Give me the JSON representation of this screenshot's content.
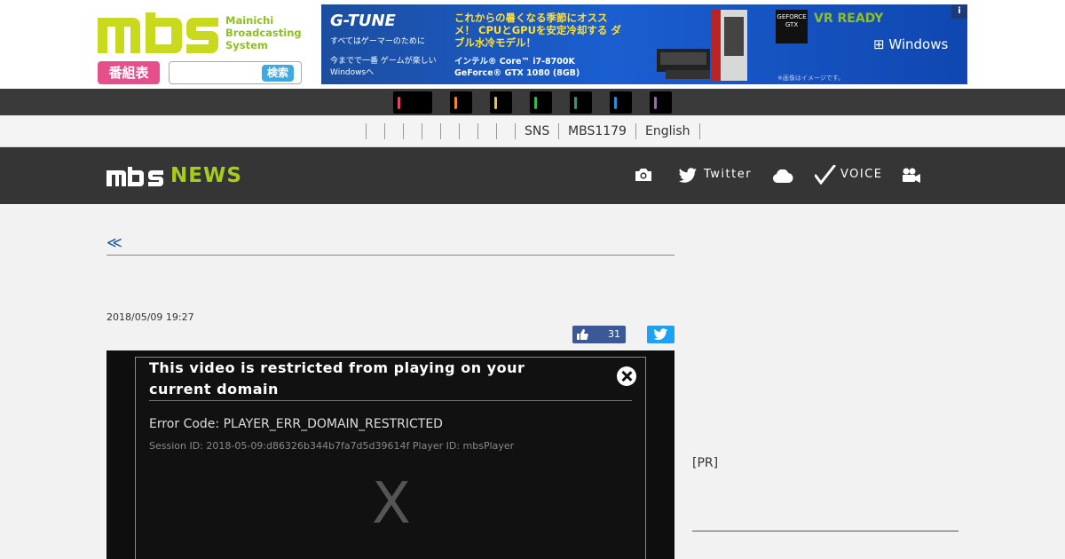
{
  "header": {
    "logo_text": [
      "Mainichi",
      "Broadcasting",
      "System"
    ],
    "program_button": "番組表",
    "search_placeholder": "",
    "search_button": "検索"
  },
  "ad": {
    "brand": "G-TUNE",
    "tagline": "すべてはゲーマーのために",
    "subcopy": "今までで一番 ゲームが楽しい Windowsへ",
    "headline": "これからの暑くなる季節にオススメ！ CPUとGPUを安定冷却する ダブル水冷モデル！",
    "spec": "インテル® Core™ i7-8700K GeForce® GTX 1080 (8GB)",
    "gpu_badge": "GEFORCE GTX",
    "vr_badge": "VR READY",
    "windows": "Windows",
    "note": "※画像はイメージです。",
    "info": "i"
  },
  "channels": [
    {
      "color": "#e8435a"
    },
    {
      "color": "#f08a2c"
    },
    {
      "color": "#f2c230"
    },
    {
      "color": "#3fb44a"
    },
    {
      "color": "#1aa37a"
    },
    {
      "color": "#2f8fd6"
    },
    {
      "color": "#b05ac8"
    }
  ],
  "subnav": {
    "items": [
      "SNS",
      "MBS1179",
      "English"
    ]
  },
  "newsbar": {
    "logo": "NEWS",
    "links": [
      {
        "icon": "camera-icon",
        "label": ""
      },
      {
        "icon": "twitter-icon",
        "label": "Twitter"
      },
      {
        "icon": "cloud-icon",
        "label": ""
      },
      {
        "icon": "check-icon",
        "label": "VOICE"
      },
      {
        "icon": "video-camera-icon",
        "label": ""
      }
    ]
  },
  "article": {
    "breadcrumb": "≪",
    "title": "",
    "date": "2018/05/09 19:27",
    "like_count": "31"
  },
  "player": {
    "error_title": "This video is restricted from playing on your current domain",
    "error_code": "Error Code: PLAYER_ERR_DOMAIN_RESTRICTED",
    "session": "Session ID: 2018-05-09:d86326b344b7fa7d5d39614f Player ID: mbsPlayer",
    "placeholder": "X"
  },
  "sidebar": {
    "pr_label": "[PR]",
    "heading": ""
  },
  "colors": {
    "brand_green": "#8ec11f",
    "news_green": "#a8cc1c",
    "program_pink": "#e4508b",
    "search_blue": "#3fa9e0",
    "link_blue": "#1e5aa0",
    "facebook": "#3b5998",
    "twitter": "#1da1f2"
  }
}
